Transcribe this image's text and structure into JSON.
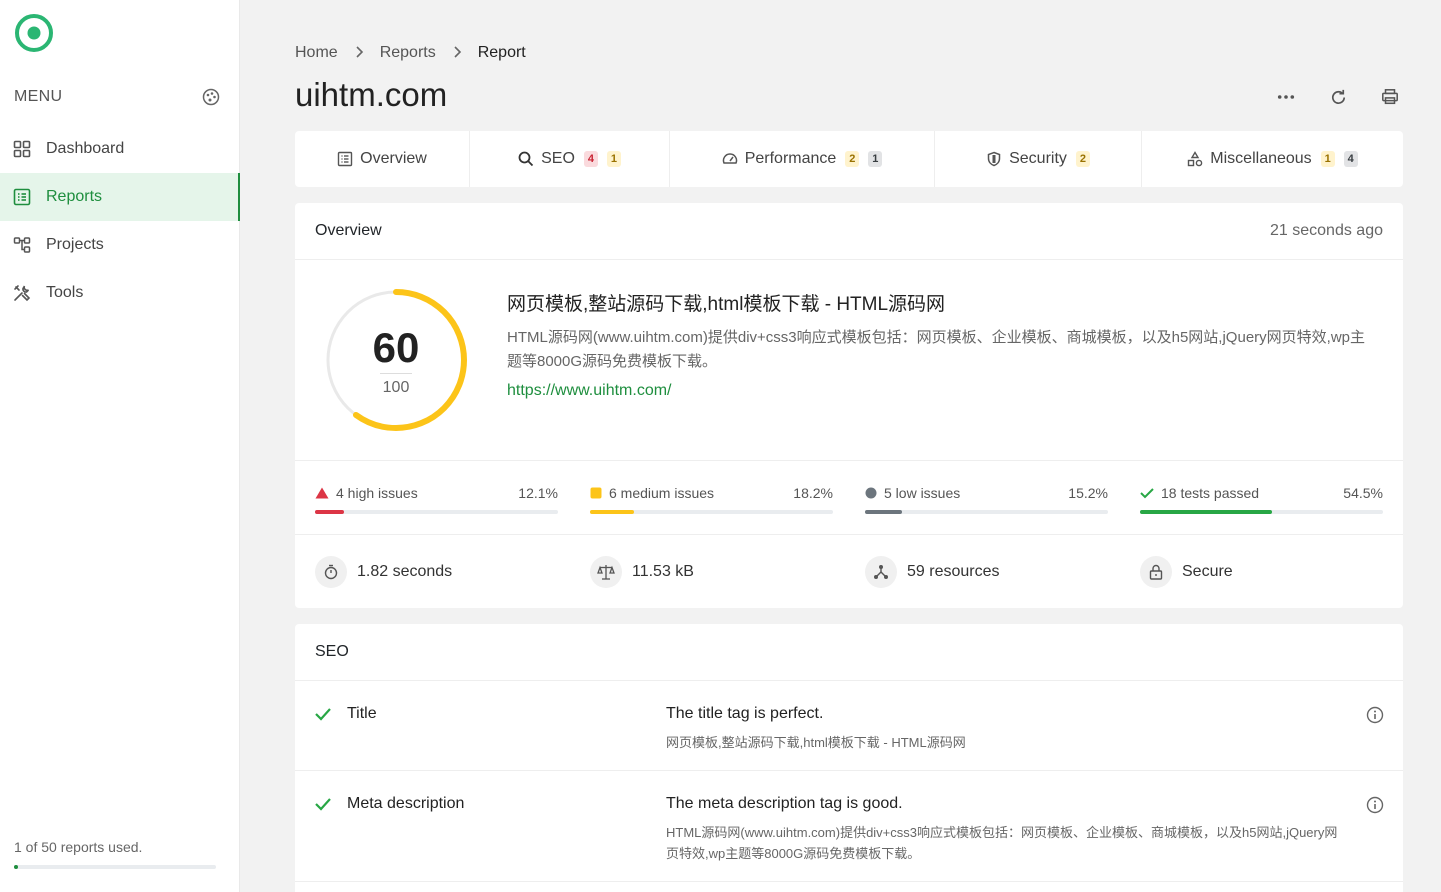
{
  "sidebar": {
    "menu_label": "MENU",
    "items": [
      {
        "label": "Dashboard",
        "icon": "grid-icon",
        "active": false
      },
      {
        "label": "Reports",
        "icon": "list-icon",
        "active": true
      },
      {
        "label": "Projects",
        "icon": "projects-icon",
        "active": false
      },
      {
        "label": "Tools",
        "icon": "tools-icon",
        "active": false
      }
    ],
    "usage_text": "1 of 50 reports used.",
    "usage_fraction": 0.02
  },
  "breadcrumb": [
    "Home",
    "Reports",
    "Report"
  ],
  "page_title": "uihtm.com",
  "tabs": [
    {
      "label": "Overview",
      "icon": "overview-icon",
      "badges": []
    },
    {
      "label": "SEO",
      "icon": "search-icon",
      "badges": [
        "4",
        "1"
      ]
    },
    {
      "label": "Performance",
      "icon": "gauge-icon",
      "badges": [
        "2",
        "1"
      ]
    },
    {
      "label": "Security",
      "icon": "shield-icon",
      "badges": [
        "2"
      ]
    },
    {
      "label": "Miscellaneous",
      "icon": "shapes-icon",
      "badges": [
        "1",
        "4"
      ]
    }
  ],
  "overview": {
    "heading": "Overview",
    "time": "21 seconds ago",
    "score": "60",
    "score_max": "100",
    "score_fraction": 0.6,
    "score_color": "#fcc419",
    "site_title": "网页模板,整站源码下载,html模板下载 - HTML源码网",
    "site_desc": "HTML源码网(www.uihtm.com)提供div+css3响应式模板包括：网页模板、企业模板、商城模板，以及h5网站,jQuery网页特效,wp主题等8000G源码免费模板下载。",
    "site_url": "https://www.uihtm.com/",
    "issues": [
      {
        "label": "4 high issues",
        "percent": "12.1%",
        "fraction": 0.121,
        "color": "#dc3545"
      },
      {
        "label": "6 medium issues",
        "percent": "18.2%",
        "fraction": 0.182,
        "color": "#fcc419"
      },
      {
        "label": "5 low issues",
        "percent": "15.2%",
        "fraction": 0.152,
        "color": "#6c757d"
      },
      {
        "label": "18 tests passed",
        "percent": "54.5%",
        "fraction": 0.545,
        "color": "#28a745"
      }
    ],
    "stats": [
      {
        "label": "1.82 seconds",
        "icon": "stopwatch-icon"
      },
      {
        "label": "11.53 kB",
        "icon": "scale-icon"
      },
      {
        "label": "59 resources",
        "icon": "resources-icon"
      },
      {
        "label": "Secure",
        "icon": "lock-icon"
      }
    ]
  },
  "seo": {
    "heading": "SEO",
    "rows": [
      {
        "name": "Title",
        "message": "The title tag is perfect.",
        "detail": "网页模板,整站源码下载,html模板下载 - HTML源码网"
      },
      {
        "name": "Meta description",
        "message": "The meta description tag is good.",
        "detail": "HTML源码网(www.uihtm.com)提供div+css3响应式模板包括：网页模板、企业模板、商城模板，以及h5网站,jQuery网页特效,wp主题等8000G源码免费模板下载。"
      }
    ]
  }
}
